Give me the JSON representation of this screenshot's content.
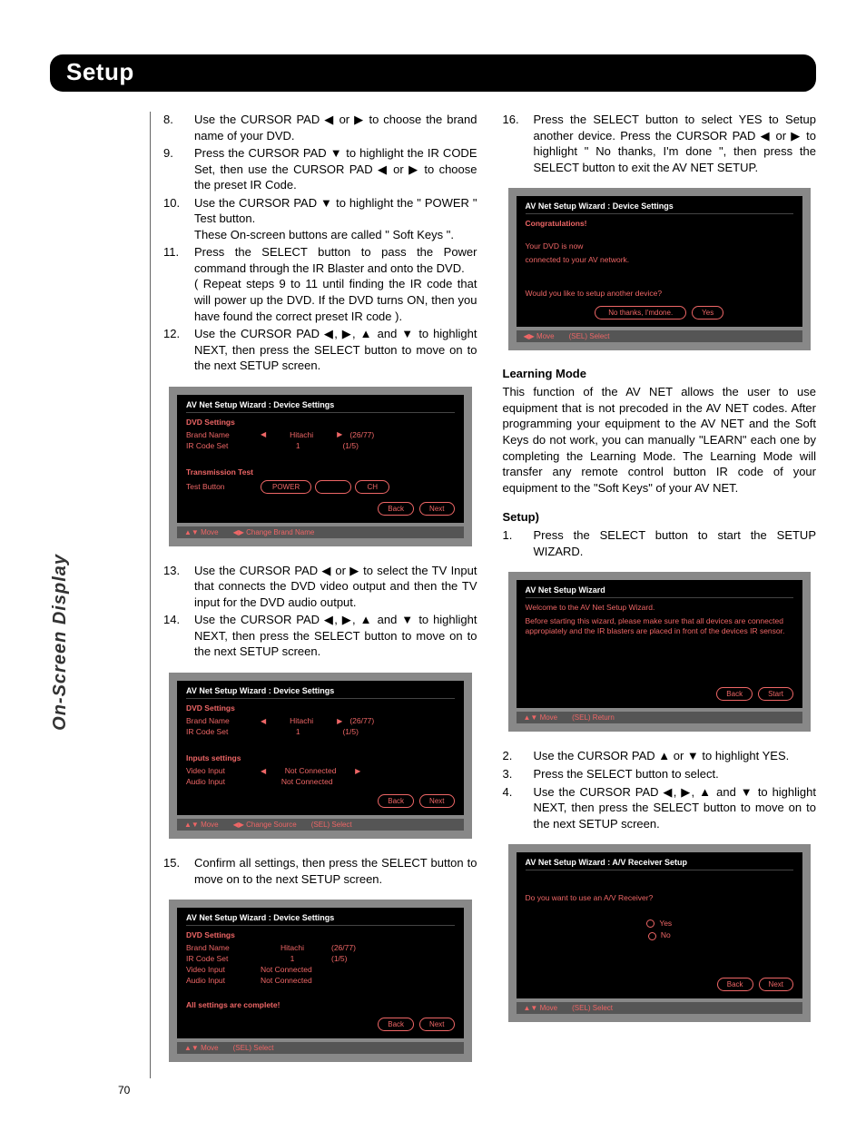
{
  "page": {
    "title": "Setup",
    "side_tab": "On-Screen Display",
    "number": "70"
  },
  "left": {
    "steps_a": [
      {
        "n": "8.",
        "t": "Use the CURSOR PAD ◀ or ▶ to choose the brand name of your DVD."
      },
      {
        "n": "9.",
        "t": "Press the CURSOR PAD ▼ to highlight the IR CODE Set, then use the CURSOR PAD ◀ or ▶ to choose the preset IR Code."
      },
      {
        "n": "10.",
        "t": "Use the CURSOR PAD ▼ to highlight the \" POWER \" Test button.\nThese On-screen buttons are called \" Soft Keys \"."
      },
      {
        "n": "11.",
        "t": "Press the SELECT button to pass the Power command through the IR Blaster and onto the DVD.\n( Repeat steps 9 to 11 until finding the IR code that will power up the DVD. If the DVD turns ON, then you have found the correct preset IR code )."
      },
      {
        "n": "12.",
        "t": "Use the CURSOR PAD ◀, ▶, ▲ and ▼ to highlight NEXT, then press the SELECT button to move on to the next SETUP screen."
      }
    ],
    "steps_b": [
      {
        "n": "13.",
        "t": "Use the CURSOR PAD ◀ or ▶ to select the TV Input that connects the DVD video output and then the TV input for the DVD audio output."
      },
      {
        "n": "14.",
        "t": "Use the CURSOR PAD ◀, ▶, ▲ and ▼ to highlight NEXT, then press the SELECT button to move on to the next SETUP screen."
      }
    ],
    "steps_c": [
      {
        "n": "15.",
        "t": "Confirm all settings, then  press the SELECT button to move on to the next SETUP screen."
      }
    ]
  },
  "right": {
    "steps_top": [
      {
        "n": "16.",
        "t": "Press the SELECT button to select YES to Setup another device.  Press the CURSOR PAD ◀ or ▶ to highlight \" No thanks, I'm done \", then press the SELECT button to exit the AV NET SETUP."
      }
    ],
    "learning_heading": "Learning Mode",
    "learning_body": "This function of the AV NET allows the user to use equipment that is not precoded in the AV NET codes. After programming your equipment to the AV NET and the Soft Keys do not work, you can manually \"LEARN\" each one by completing the Learning Mode.  The Learning Mode will transfer any remote control button IR code of your equipment to the \"Soft Keys\" of your AV NET.",
    "setup_heading": "Setup)",
    "steps_setup_a": [
      {
        "n": "1.",
        "t": "Press the SELECT button to start the SETUP WIZARD."
      }
    ],
    "steps_setup_b": [
      {
        "n": "2.",
        "t": "Use the CURSOR PAD ▲ or ▼ to highlight YES."
      },
      {
        "n": "3.",
        "t": "Press the SELECT button to select."
      },
      {
        "n": "4.",
        "t": "Use the CURSOR PAD ◀, ▶, ▲ and ▼ to highlight NEXT, then press the SELECT button to move on to the next SETUP screen."
      }
    ]
  },
  "osd1": {
    "title": "AV Net Setup Wizard : Device Settings",
    "sub1": "DVD Settings",
    "brand_lbl": "Brand Name",
    "brand_val": "Hitachi",
    "brand_idx": "(26/77)",
    "ir_lbl": "IR Code Set",
    "ir_val": "1",
    "ir_idx": "(1/5)",
    "sub2": "Transmission Test",
    "test_lbl": "Test Button",
    "footer_move": "Move",
    "footer_change": "Change Brand Name",
    "back": "Back",
    "next": "Next",
    "b_power": "POWER",
    "b_ch": "CH"
  },
  "osd2": {
    "title": "AV Net Setup Wizard : Device Settings",
    "sub1": "DVD Settings",
    "brand_lbl": "Brand Name",
    "brand_val": "Hitachi",
    "brand_idx": "(26/77)",
    "ir_lbl": "IR Code Set",
    "ir_val": "1",
    "ir_idx": "(1/5)",
    "sub2": "Inputs settings",
    "vi_lbl": "Video Input",
    "vi_val": "Not Connected",
    "ai_lbl": "Audio Input",
    "ai_val": "Not Connected",
    "footer_move": "Move",
    "footer_change": "Change Source",
    "footer_sel": "Select",
    "back": "Back",
    "next": "Next"
  },
  "osd3": {
    "title": "AV Net Setup Wizard : Device Settings",
    "sub1": "DVD Settings",
    "brand_lbl": "Brand Name",
    "brand_val": "Hitachi",
    "brand_idx": "(26/77)",
    "ir_lbl": "IR Code Set",
    "ir_val": "1",
    "ir_idx": "(1/5)",
    "vi_lbl": "Video Input",
    "vi_val": "Not Connected",
    "ai_lbl": "Audio Input",
    "ai_val": "Not Connected",
    "complete": "All settings are complete!",
    "footer_move": "Move",
    "footer_sel": "Select",
    "back": "Back",
    "next": "Next"
  },
  "osd4": {
    "title": "AV Net Setup Wizard : Device Settings",
    "l1": "Congratulations!",
    "l2": "Your DVD is now",
    "l3": "connected to your AV network.",
    "q": "Would you like to setup another device?",
    "no": "No thanks, I'mdone.",
    "yes": "Yes",
    "footer_move": "Move",
    "footer_sel": "Select"
  },
  "osd5": {
    "title": "AV Net Setup Wizard",
    "l1": "Welcome to the AV Net Setup Wizard.",
    "l2": "Before starting this wizard, please make sure that all devices are connected appropiately and the IR blasters are placed in front of the devices IR sensor.",
    "back": "Back",
    "start": "Start",
    "footer_move": "Move",
    "footer_ret": "Return"
  },
  "osd6": {
    "title": "AV Net Setup Wizard : A/V Receiver Setup",
    "q": "Do you want to use an A/V Receiver?",
    "yes": "Yes",
    "no": "No",
    "back": "Back",
    "next": "Next",
    "footer_move": "Move",
    "footer_sel": "Select"
  }
}
